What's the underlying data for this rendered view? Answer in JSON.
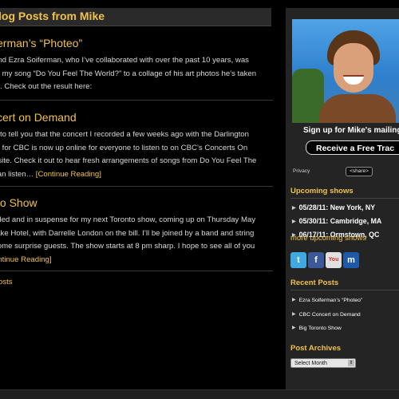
{
  "main": {
    "heading": "log Posts from Mike",
    "posts": [
      {
        "title": "erman’s “Photeo”",
        "lines": [
          "end Ezra Soiferman, who I’ve collaborated with over the past 10 years, was",
          "ut my song “Do You Feel The World?” to a collage of his art photos he’s taken",
          "rs. Check out the result here:"
        ]
      },
      {
        "title": "cert on Demand",
        "lines": [
          "e to tell you that the concert I recorded a few weeks ago with the Darlington",
          "et for CBC is now up online for everyone to listen to on CBC’s Concerts On",
          "osite. Check it out to hear fresh arrangements of songs from Do You Feel The",
          "can listen… "
        ],
        "link": "[Continue Reading]"
      },
      {
        "title": "to Show",
        "lines": [
          "rilled and in suspense for my next Toronto show, coming up on Thursday May",
          "rake Hotel, with Darrelle London on the bill. I’ll be joined by a band and string",
          "some surprise guests. The show starts at 8 pm sharp. I hope to see all of you",
          ""
        ],
        "link": "ontinue Reading]"
      }
    ],
    "older_link": "osts"
  },
  "sidebar": {
    "signup_title": "Sign up for Mike's mailing",
    "receive_button": "Receive a Free Trac",
    "privacy": "Privacy",
    "share": "<share>",
    "upcoming_heading": "Upcoming shows",
    "shows": [
      "05/28/11: New York, NY",
      "05/30/11: Cambridge, MA",
      "06/17/11: Ormstown, QC"
    ],
    "more_shows": "more upcoming shows",
    "recent_heading": "Recent Posts",
    "recent_posts": [
      "Ezra Soiferman’s “Photeo”",
      "CBC Concert on Demand",
      "Big Toronto Show"
    ],
    "archives_heading": "Post Archives",
    "archives_select": "Select Month",
    "social_icons": [
      "twitter-icon",
      "facebook-icon",
      "youtube-icon",
      "myspace-icon"
    ]
  },
  "colors": {
    "accent": "#f0c24a",
    "background": "#000000",
    "sidebar_bg": "#242424"
  }
}
